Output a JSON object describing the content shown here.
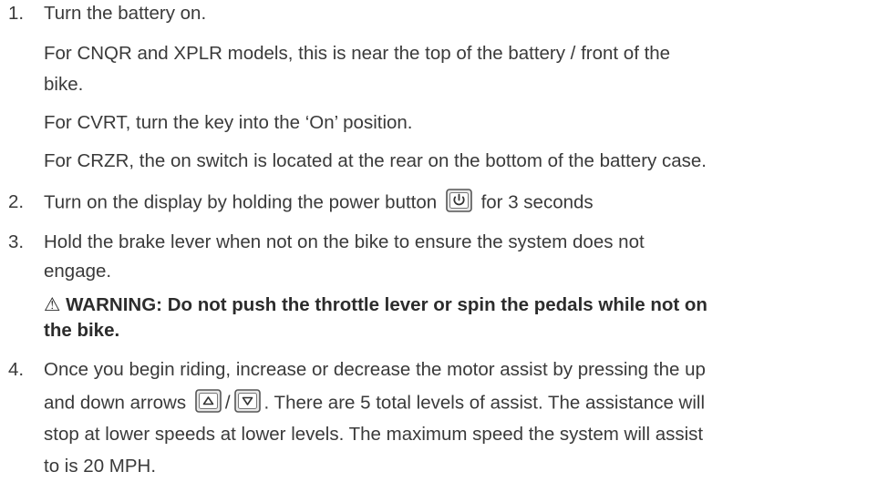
{
  "steps": [
    {
      "number": "1.",
      "text": "Turn the battery on.",
      "notes": [
        "For CNQR and XPLR models, this is near the top of the battery / front of the",
        "bike.",
        "For CVRT, turn the key into the ‘On’ position.",
        "For CRZR, the on switch is located at the rear on the bottom of the battery case."
      ]
    },
    {
      "number": "2.",
      "text_before": "Turn on the display by holding the power button",
      "text_after": "for 3 seconds",
      "icon": "power-button-icon"
    },
    {
      "number": "3.",
      "lines": [
        "Hold the brake lever when not on the bike to ensure the system does not",
        "engage."
      ],
      "warning": {
        "icon": "warning-triangle-icon",
        "symbol": "⚠",
        "lines": [
          "WARNING: Do not push the throttle lever or spin the pedals while not on",
          "the bike."
        ]
      }
    },
    {
      "number": "4.",
      "line1": "Once you begin riding, increase or decrease the motor assist by pressing the up",
      "line2_before": "and down arrows",
      "separator": "/",
      "line2_after": ". There are 5 total levels of assist. The assistance will",
      "line3": "stop at lower speeds at lower levels. The maximum speed the  system will assist",
      "line4": "to is 20 MPH.",
      "icons": [
        "up-arrow-button-icon",
        "down-arrow-button-icon"
      ]
    }
  ]
}
